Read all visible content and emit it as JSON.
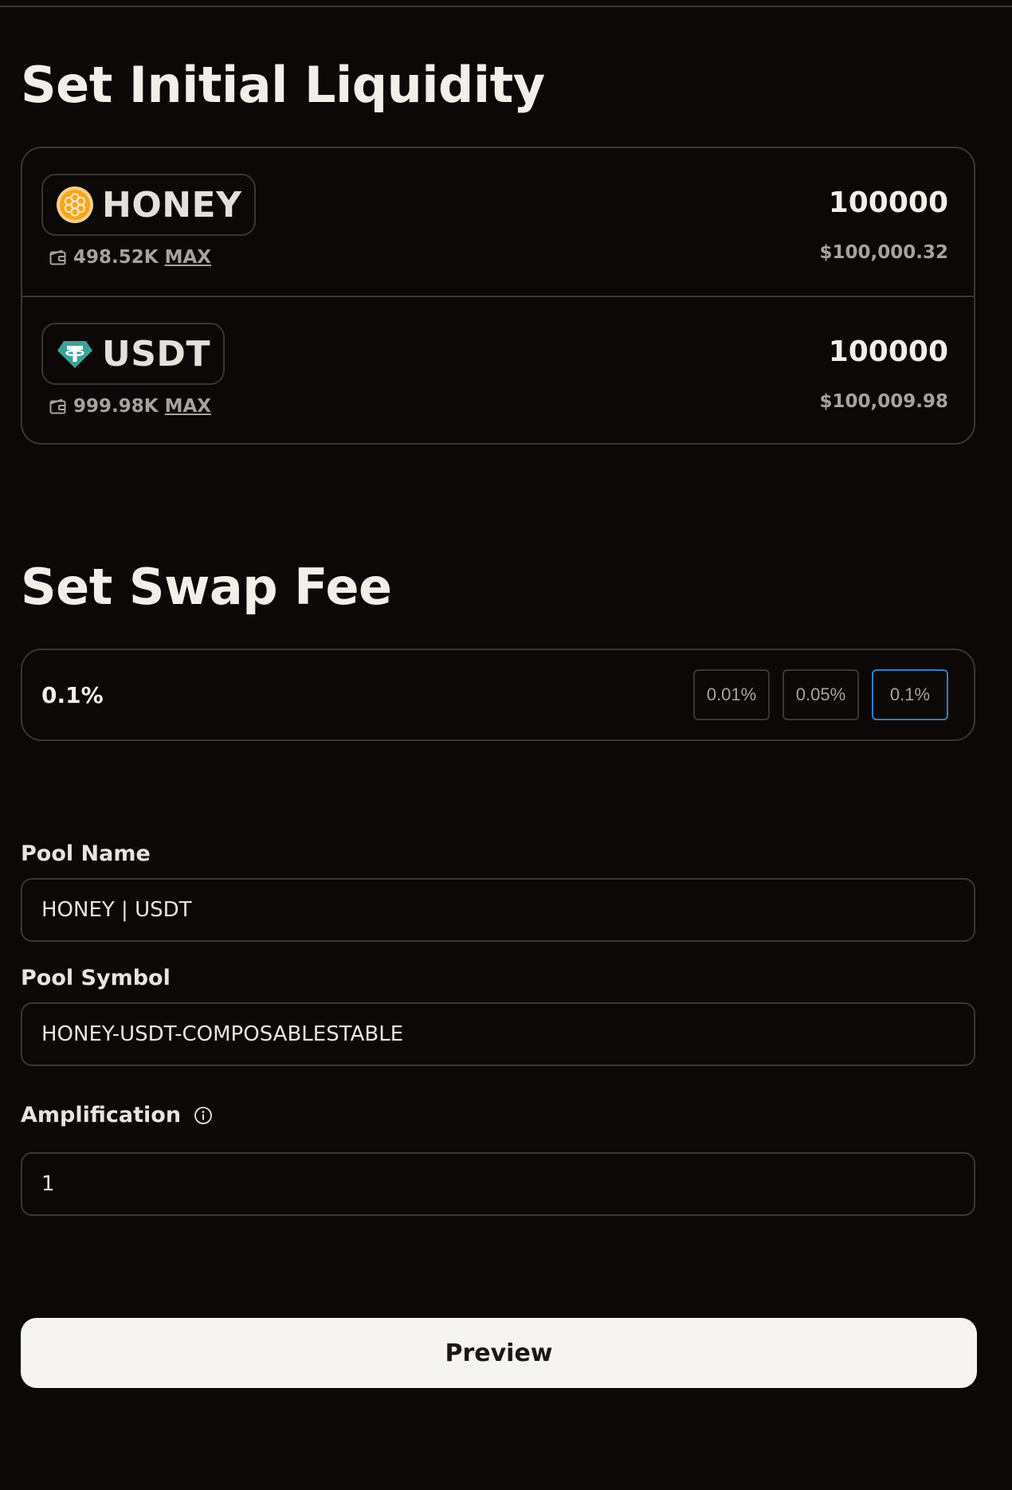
{
  "liquidity": {
    "title": "Set Initial Liquidity",
    "tokens": [
      {
        "symbol": "HONEY",
        "icon": "honey-token-icon",
        "balance": "498.52K",
        "max_label": "MAX",
        "amount": "100000",
        "usd_value": "$100,000.32",
        "color": "#f4a71d"
      },
      {
        "symbol": "USDT",
        "icon": "tether-token-icon",
        "balance": "999.98K",
        "max_label": "MAX",
        "amount": "100000",
        "usd_value": "$100,009.98",
        "color": "#3aa397"
      }
    ]
  },
  "swap_fee": {
    "title": "Set Swap Fee",
    "current": "0.1%",
    "options": [
      "0.01%",
      "0.05%",
      "0.1%"
    ],
    "selected": "0.1%",
    "selected_color": "#2f7fc4"
  },
  "pool": {
    "name_label": "Pool Name",
    "name_value": "HONEY | USDT",
    "symbol_label": "Pool Symbol",
    "symbol_value": "HONEY-USDT-COMPOSABLESTABLE",
    "amplification_label": "Amplification",
    "amplification_icon": "info-icon",
    "amplification_value": "1"
  },
  "actions": {
    "preview_label": "Preview"
  }
}
